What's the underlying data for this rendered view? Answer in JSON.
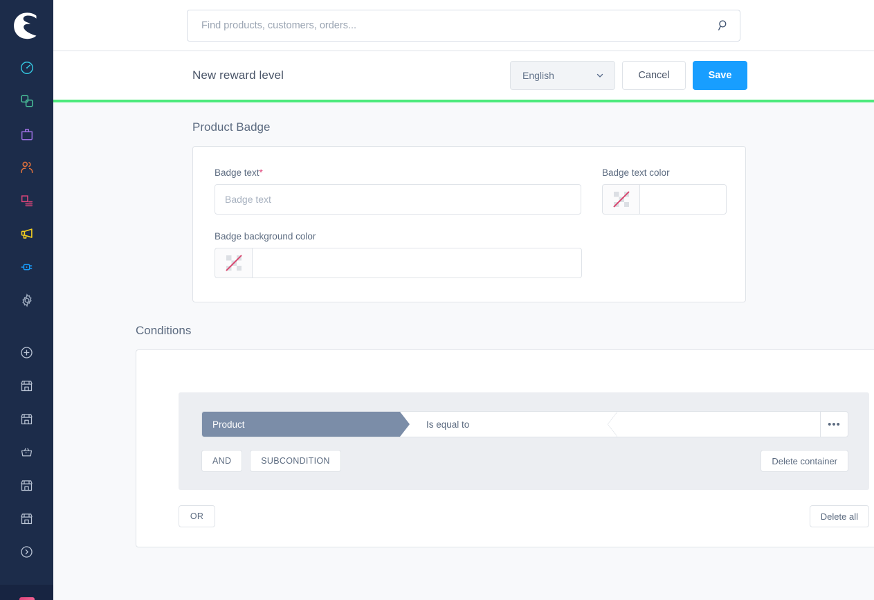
{
  "sidebar": {
    "logo_name": "shopware-logo",
    "items": [
      {
        "name": "dashboard",
        "icon": "gauge-icon",
        "color": "#34c6df"
      },
      {
        "name": "catalogues",
        "icon": "copy-icon",
        "color": "#4bc49b"
      },
      {
        "name": "orders",
        "icon": "bag-icon",
        "color": "#9b6fe0"
      },
      {
        "name": "customers",
        "icon": "people-icon",
        "color": "#e8743b"
      },
      {
        "name": "content",
        "icon": "document-icon",
        "color": "#e0457b"
      },
      {
        "name": "marketing",
        "icon": "megaphone-icon",
        "color": "#f5d020"
      },
      {
        "name": "extensions",
        "icon": "plug-icon",
        "color": "#189eff"
      },
      {
        "name": "settings",
        "icon": "gear-icon",
        "color": "#98a6ba"
      }
    ],
    "shortcuts": [
      {
        "name": "add-sales-channel",
        "icon": "plus-circle-icon",
        "color": "#bcc6d6"
      },
      {
        "name": "sales-channel-1",
        "icon": "storefront-icon",
        "color": "#bcc6d6"
      },
      {
        "name": "sales-channel-2",
        "icon": "storefront-icon",
        "color": "#bcc6d6"
      },
      {
        "name": "sales-channel-3",
        "icon": "basket-icon",
        "color": "#bcc6d6"
      },
      {
        "name": "sales-channel-4",
        "icon": "storefront-icon",
        "color": "#bcc6d6"
      },
      {
        "name": "sales-channel-5",
        "icon": "storefront-icon",
        "color": "#bcc6d6"
      },
      {
        "name": "collapse-menu",
        "icon": "chevron-circle-right-icon",
        "color": "#bcc6d6"
      }
    ]
  },
  "search": {
    "placeholder": "Find products, customers, orders...",
    "value": "",
    "icon": "search-icon"
  },
  "actionbar": {
    "title": "New reward level",
    "language_value": "English",
    "language_icon": "chevron-down-icon",
    "cancel_label": "Cancel",
    "save_label": "Save"
  },
  "colors": {
    "accent_blue": "#189eff",
    "progress_green": "#4dea7c",
    "sidebar_bg": "#1c2c4a",
    "page_bg": "#f8f9fb",
    "condition_pill": "#7b8da8",
    "container_bg": "#eceef2",
    "required_red": "#e0457b"
  },
  "product_badge": {
    "section_title": "Product Badge",
    "badge_text": {
      "label": "Badge text",
      "required_mark": "*",
      "placeholder": "Badge text",
      "value": ""
    },
    "badge_text_color": {
      "label": "Badge text color",
      "value": "",
      "swatch_icon": "transparent-color-swatch-icon"
    },
    "badge_background_color": {
      "label": "Badge background color",
      "value": "",
      "swatch_icon": "transparent-color-swatch-icon"
    }
  },
  "conditions": {
    "section_title": "Conditions",
    "rows": [
      {
        "field": "Product",
        "operator": "Is equal to",
        "value": "",
        "more_icon": "ellipsis-icon"
      }
    ],
    "and_label": "AND",
    "subcondition_label": "SUBCONDITION",
    "delete_container_label": "Delete container",
    "or_label": "OR",
    "delete_all_label": "Delete all"
  }
}
